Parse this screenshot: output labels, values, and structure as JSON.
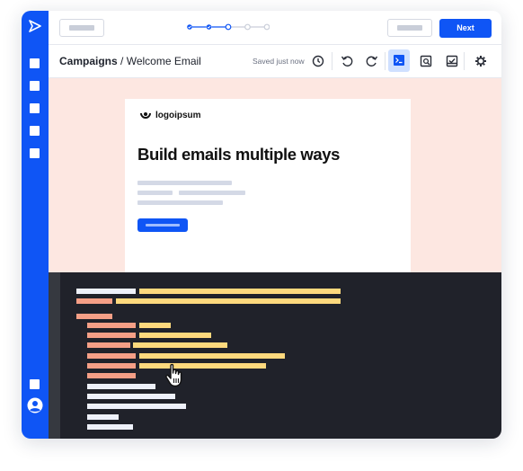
{
  "stepper": {
    "steps": 5,
    "completed": 2,
    "current": 3
  },
  "next_button": {
    "label": "Next"
  },
  "breadcrumb": {
    "parent": "Campaigns",
    "separator": " / ",
    "current": "Welcome Email"
  },
  "save_status": "Saved just now",
  "email": {
    "logo_text": "logoipsum",
    "headline": "Build emails multiple ways"
  },
  "colors": {
    "brand_blue": "#0f55f5",
    "preview_background": "#fde7e1",
    "code_background": "#20222a",
    "active_tool": "#cfe0ff"
  },
  "icons": {
    "sidebar": [
      "send-icon",
      "nav-square-icon",
      "user-avatar-icon"
    ],
    "toolbar": [
      "history-icon",
      "undo-icon",
      "redo-icon",
      "code-view-icon",
      "preview-icon",
      "test-send-icon",
      "settings-icon"
    ],
    "canvas": [
      "logo-mark-icon",
      "hand-cursor-icon"
    ]
  },
  "active_tool": "code-view"
}
